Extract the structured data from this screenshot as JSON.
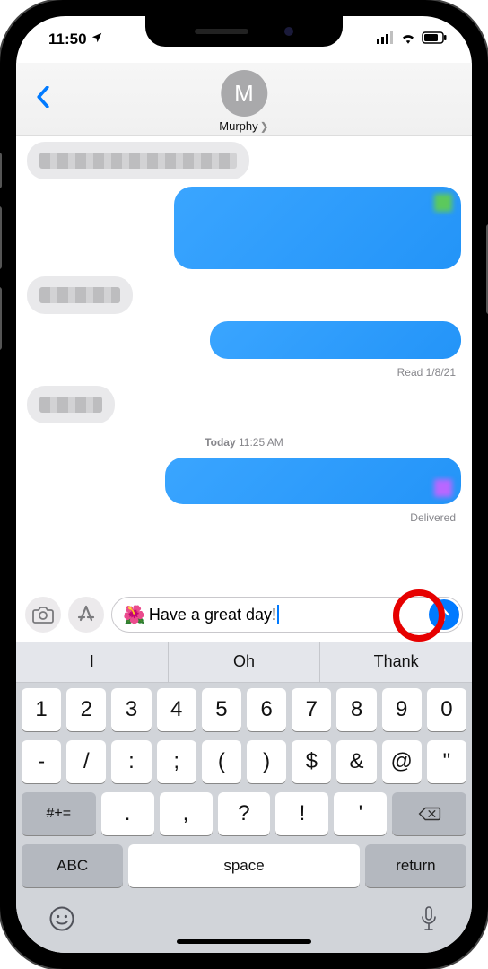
{
  "status_bar": {
    "time": "11:50"
  },
  "header": {
    "contact_initial": "M",
    "contact_name": "Murphy"
  },
  "messages": {
    "read_status": "Read 1/8/21",
    "today_divider_bold": "Today",
    "today_divider_time": "11:25 AM",
    "delivered_status": "Delivered"
  },
  "composer": {
    "emoji": "🌺",
    "text": "Have a great day!"
  },
  "suggestions": [
    "I",
    "Oh",
    "Thank"
  ],
  "keyboard": {
    "row1": [
      "1",
      "2",
      "3",
      "4",
      "5",
      "6",
      "7",
      "8",
      "9",
      "0"
    ],
    "row2": [
      "-",
      "/",
      ":",
      ";",
      "(",
      ")",
      "$",
      "&",
      "@",
      "\""
    ],
    "row3_shift": "#+=",
    "row3": [
      ".",
      ",",
      "?",
      "!",
      "'"
    ],
    "abc": "ABC",
    "space": "space",
    "return": "return"
  }
}
